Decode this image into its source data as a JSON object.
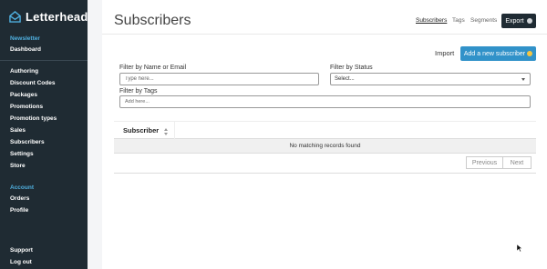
{
  "brand": {
    "name": "Letterhead"
  },
  "sidebar": {
    "newsletter_heading": "Newsletter",
    "dashboard": "Dashboard",
    "items": [
      "Authoring",
      "Discount Codes",
      "Packages",
      "Promotions",
      "Promotion types",
      "Sales",
      "Subscribers",
      "Settings",
      "Store"
    ],
    "account_heading": "Account",
    "account_items": [
      "Orders",
      "Profile"
    ],
    "footer_items": [
      "Support",
      "Log out"
    ]
  },
  "header": {
    "title": "Subscribers",
    "tabs": [
      "Subscribers",
      "Tags",
      "Segments"
    ],
    "export_label": "Export"
  },
  "actions": {
    "import_label": "Import",
    "add_label": "Add a new subscriber"
  },
  "filters": {
    "name_label": "Filter by Name or Email",
    "name_placeholder": "Type here...",
    "status_label": "Filter by Status",
    "status_value": "Select...",
    "tags_label": "Filter by Tags",
    "tags_placeholder": "Add here..."
  },
  "table": {
    "column": "Subscriber",
    "empty_message": "No matching records found"
  },
  "pagination": {
    "previous": "Previous",
    "next": "Next"
  },
  "colors": {
    "sidebar_bg": "#1f2b33",
    "accent": "#3192c9",
    "section_heading": "#4fb0e0"
  }
}
